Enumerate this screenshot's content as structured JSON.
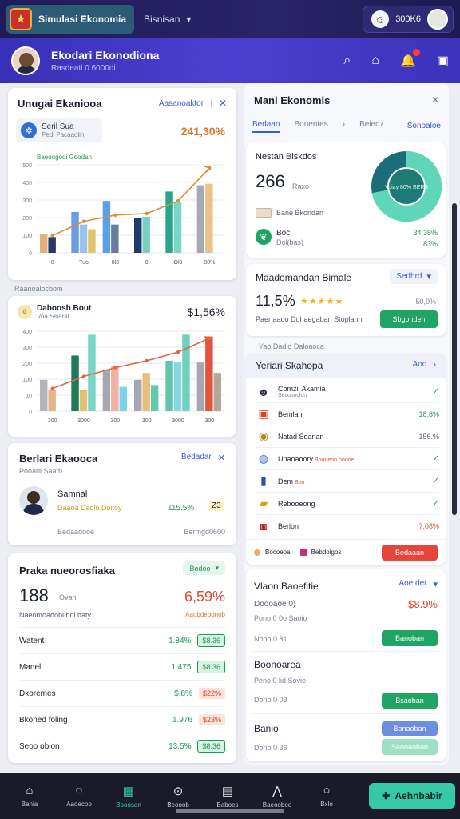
{
  "topbar": {
    "app_name": "Simulasi Ekonomia",
    "menu_label": "Bisnisan",
    "count": "300K6"
  },
  "header": {
    "title": "Ekodari Ekonodiona",
    "subtitle": "Rasdeati 0 6000di"
  },
  "card1": {
    "title": "Unugai Ekaniooa",
    "action": "Aasanoaktor",
    "chip_title": "Seril Sua",
    "chip_sub": "Pedi Pacaaolin",
    "value": "241,30%",
    "series_label": "Baeoogodi Goodan",
    "chart_data": {
      "type": "bar",
      "categories": [
        "0",
        "Tuo",
        "0l3",
        "0",
        "Ol0",
        "80%"
      ],
      "y_ticks": [
        "0",
        "100",
        "200",
        "300",
        "400",
        "500"
      ],
      "bars": [
        {
          "values": [
            120,
            260,
            330,
            220,
            390,
            430
          ]
        },
        {
          "values": [
            100,
            180,
            180,
            230,
            320,
            440
          ]
        },
        {
          "values": [
            0,
            150,
            0,
            0,
            0,
            0
          ]
        }
      ],
      "trend": [
        110,
        200,
        240,
        250,
        330,
        540
      ],
      "ylim": [
        0,
        560
      ]
    }
  },
  "section_label": "Raanoalocbom",
  "card2": {
    "title": "Daboosb Bout",
    "sub": "Voa Ssiarat",
    "value": "$1,56%",
    "chart_data": {
      "type": "bar",
      "categories": [
        "300",
        "3000",
        "300",
        "300",
        "3000",
        "300"
      ],
      "y_ticks": [
        "0",
        "10",
        "100",
        "200",
        "300",
        "400"
      ],
      "bars": [
        {
          "values": [
            180,
            320,
            240,
            180,
            290,
            280
          ]
        },
        {
          "values": [
            120,
            120,
            260,
            220,
            280,
            430
          ]
        },
        {
          "values": [
            0,
            440,
            140,
            150,
            440,
            220
          ]
        }
      ],
      "trend": [
        130,
        200,
        250,
        290,
        340,
        420
      ],
      "ylim": [
        0,
        460
      ]
    }
  },
  "card3": {
    "title": "Berlari Ekaooca",
    "sub": "Pooarli Saatb",
    "action": "Bedadar",
    "person_name": "Samnal",
    "person_meta": "Daaoa Dadlo Doitoy",
    "person_value": "115.5%",
    "person_right": "Z3",
    "foot_left": "Bedaadooe",
    "foot_right": "Bermgd0600"
  },
  "card4": {
    "title": "Praka nueorosfiaka",
    "action": "Bodoo",
    "big_value": "188",
    "big_unit": "Ovan",
    "big_sub": "Naeomoaoobl bdi baty",
    "pct": "6,59%",
    "pct_sub": "Aaobdebonob",
    "rows": [
      {
        "name": "Watent",
        "value": "1.84%",
        "pill": "$8.36"
      },
      {
        "name": "Manel",
        "value": "1.475",
        "pill": "$8.36"
      },
      {
        "name": "Dkoremes",
        "value": "$.8%",
        "pill": "$22%"
      },
      {
        "name": "Bkoned foling",
        "value": "1.976",
        "pill": "$23%"
      },
      {
        "name": "Seoo oblon",
        "value": "13.5%",
        "pill": "$8.36"
      }
    ]
  },
  "right": {
    "title": "Mani Ekonomis",
    "tabs": [
      "Bedaan",
      "Bonentes",
      "Beiedz",
      "Sonoaloe"
    ],
    "stat_title": "Nestan Biskdos",
    "stat_value": "266",
    "stat_unit": "Raxo",
    "stat_label": "Bane Bkondan",
    "stat_row_title": "Boc",
    "stat_row_sub": "Dol(bas)",
    "stat_row_v1": "34.35%",
    "stat_row_v2": "83%",
    "donut_label": "Voiay 80% BERS",
    "donut_pct": 72,
    "market_title": "Maadomandan Bimale",
    "market_action": "Sedhrd",
    "rating_value": "11,5%",
    "rating_right": "50,0%",
    "rating_sub": "Paer aaoo Dohaegaban Stoplann",
    "rating_button": "Sbgonden",
    "section_label": "Yao Dadlo Daloaoca",
    "list_title": "Yeriari Skahopa",
    "list_action": "Aoo",
    "items": [
      {
        "name": "Comzil Akamia",
        "sub": "Secosoclon",
        "value": "",
        "icon": "avatar-icon"
      },
      {
        "name": "Bemlan",
        "sub": "",
        "value": "18.8%",
        "icon": "box-icon"
      },
      {
        "name": "Natad Sdanan",
        "sub": "",
        "value": "156.%",
        "icon": "coin-icon"
      },
      {
        "name": "Unaoaoory",
        "sub": "Booneoo ooooe",
        "value": "",
        "icon": "globe-icon"
      },
      {
        "name": "Dem",
        "sub": "Boo",
        "value": "",
        "icon": "phone-icon"
      },
      {
        "name": "Rebooeong",
        "sub": "",
        "value": "",
        "icon": "gold-icon"
      },
      {
        "name": "Berlon",
        "sub": "",
        "value": "7,08%",
        "icon": "can-icon"
      }
    ],
    "list_foot_left": "Bocoeoa",
    "list_foot_mid": "Bebdoigos",
    "list_button": "Bedaaan",
    "bene_title": "Vlaon Baoefitie",
    "bene_action": "Aoetder",
    "bene_line1": "Doooaoe 0)",
    "bene_value": "$8.9%",
    "bene_line2": "Pono 0 0o Saoio",
    "bene_line3": "Nono 0 81",
    "bene_btn1": "Banoban",
    "bene2_title": "Boonoarea",
    "bene2_line1": "Peno 0 lid Sovie",
    "bene2_line2": "Dono 0 03",
    "bene2_btn": "Bsaoban",
    "bene3_title": "Banio",
    "bene3_line": "Dono 0 36",
    "bene3_btn1": "Bonaoban",
    "bene3_btn2": "Sanoaoban"
  },
  "nav": {
    "items": [
      "Bania",
      "Aaoecoo",
      "Booosan",
      "Beooob",
      "Baboes",
      "Baeoobeo",
      "Bxlo"
    ],
    "cta": "Aehnbabir"
  }
}
